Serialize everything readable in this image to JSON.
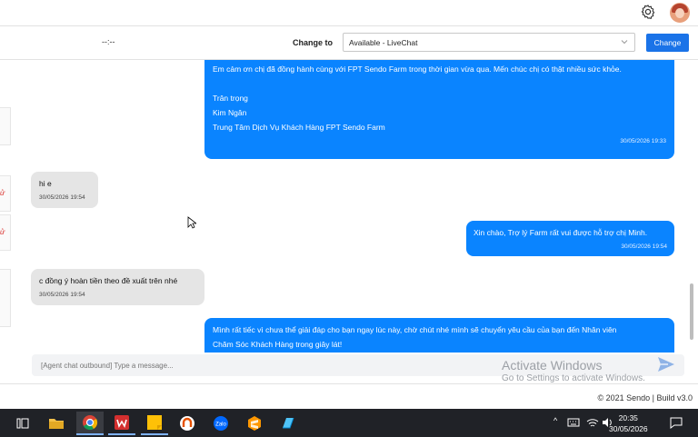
{
  "header": {
    "settings_icon": "gear-icon",
    "avatar_icon": "user-avatar"
  },
  "status": {
    "timer": "--:--",
    "change_to_label": "Change to",
    "selected_status": "Available - LiveChat",
    "change_button": "Change"
  },
  "messages": [
    {
      "dir": "out",
      "lines": [
        "Em cảm ơn chị đã đồng hành cùng với FPT Sendo Farm trong thời gian vừa qua. Mến chúc chị có thật nhiều sức khỏe.",
        "",
        "Trân trọng",
        "Kim Ngân",
        "Trung Tâm Dịch Vụ Khách Hàng FPT Sendo Farm"
      ],
      "time": "30/05/2026 19:33"
    },
    {
      "dir": "in",
      "lines": [
        "hi e"
      ],
      "time": "30/05/2026 19:54"
    },
    {
      "dir": "out",
      "lines": [
        "Xin chào, Trợ lý Farm rất vui được hỗ trợ chị Minh."
      ],
      "time": "30/05/2026 19:54"
    },
    {
      "dir": "in",
      "lines": [
        "c đồng ý hoàn tiền theo đề xuất trên nhé"
      ],
      "time": "30/05/2026 19:54"
    },
    {
      "dir": "out",
      "lines": [
        "Mình rất tiếc vì chưa thể giải đáp cho bạn ngay lúc này, chờ chút nhé mình sẽ chuyển yêu cầu của bạn đến Nhân viên",
        "Chăm Sóc Khách Hàng trong giây lát!"
      ],
      "time": ""
    }
  ],
  "composer": {
    "placeholder": "[Agent chat outbound] Type a message...",
    "send_icon": "send-icon"
  },
  "watermark": {
    "line1": "Activate Windows",
    "line2": "Go to Settings to activate Windows."
  },
  "footer": {
    "text": "© 2021 Sendo | Build v3.0"
  },
  "taskbar": {
    "apps": [
      "task-view",
      "file-explorer",
      "chrome",
      "wps-office",
      "sticky-notes",
      "ultraviewer",
      "zalo",
      "sublime-text",
      "app-generic"
    ],
    "tray_arrow": "^",
    "clock_time": "20:35",
    "clock_date": "30/05/2026"
  },
  "colors": {
    "accent": "#1a73e8",
    "outgoing_bubble": "#0a84ff",
    "incoming_bubble": "#e5e5e5",
    "taskbar": "#202227"
  }
}
